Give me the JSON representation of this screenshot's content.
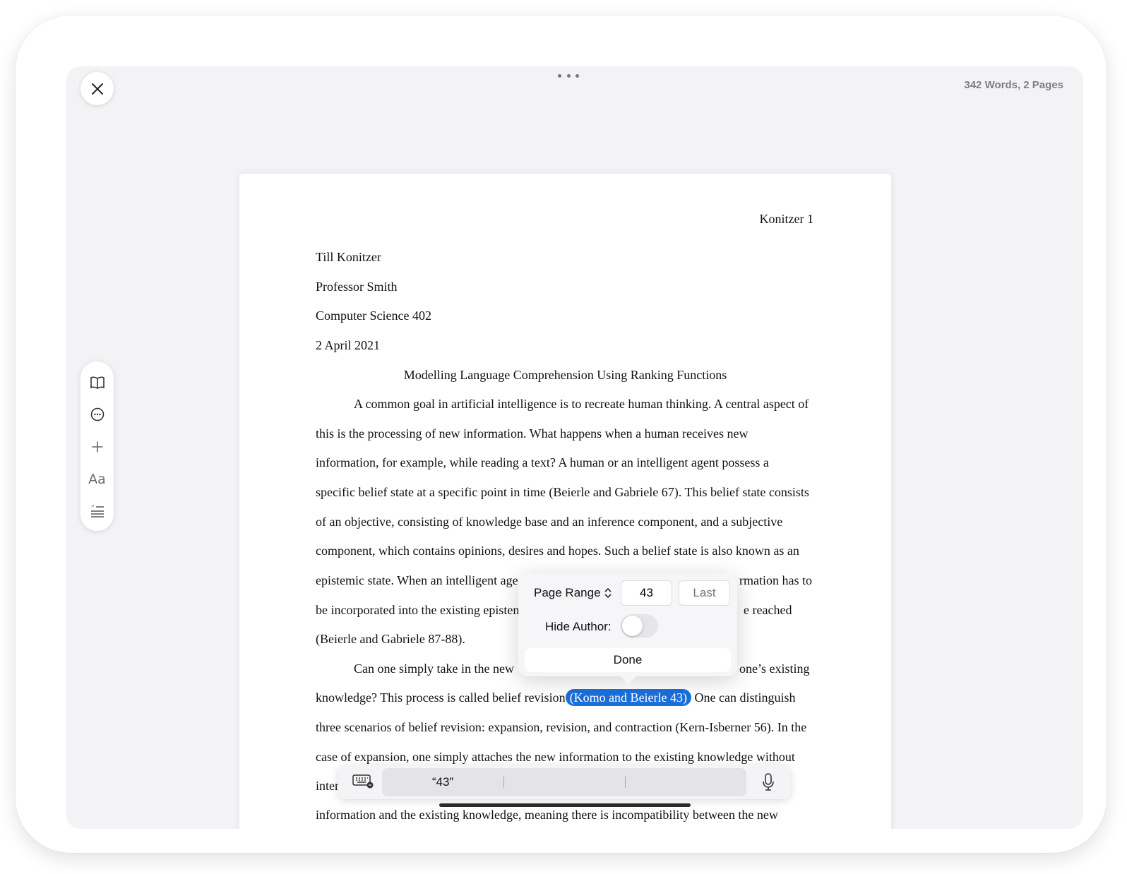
{
  "header": {
    "word_count": "342 Words, 2 Pages"
  },
  "document": {
    "running_head": "Konitzer 1",
    "heading_lines": [
      "Till Konitzer",
      "Professor Smith",
      "Computer Science 402",
      "2 April 2021"
    ],
    "title": "Modelling Language Comprehension Using Ranking Functions",
    "p1": [
      "A common goal in artificial intelligence is to recreate human thinking. A central aspect of",
      "this is the processing of new information. What happens when a human receives new",
      "information, for example, while reading a text? A human or an intelligent agent possess a",
      "specific belief state at a specific point in time (Beierle and Gabriele 67). This belief state consists",
      "of an objective, consisting of knowledge base and an inference component, and a subjective",
      "component, which contains opinions, desires and hopes. Such a belief state is also known as an"
    ],
    "p1_partial": {
      "l7_left": "epistemic state. When an intelligent age",
      "l7_right": "rmation has to",
      "l8_left": "be incorporated into the existing episten",
      "l8_right": "e reached",
      "l9": "(Beierle and Gabriele 87-88)."
    },
    "p2": {
      "l1_left": "Can one simply take in the new",
      "l1_right": "one’s existing",
      "l2_before": "knowledge? This process is called belief revision",
      "l2_cite": "(Komo and Beierle 43)",
      "l2_after": "One can distinguish",
      "l3": "three scenarios of belief revision: expansion, revision, and contraction (Kern-Isberner 56). In the",
      "l4": "case of expansion, one simply attaches the new information to the existing knowledge without",
      "l5_partial": "inter",
      "l6_partial": "information and the existing knowledge, meaning there is incompatibility between the new"
    }
  },
  "popover": {
    "page_range_label": "Page Range",
    "first_value": "43",
    "last_placeholder": "Last",
    "hide_author_label": "Hide Author:",
    "hide_author_on": false,
    "done_label": "Done"
  },
  "keyboard": {
    "suggestions": [
      "“43”",
      "",
      ""
    ]
  },
  "toolbar": {
    "icons": [
      "book-icon",
      "comment-icon",
      "plus-icon",
      "text-format-icon",
      "quote-list-icon"
    ],
    "text_format_label": "Aa"
  }
}
